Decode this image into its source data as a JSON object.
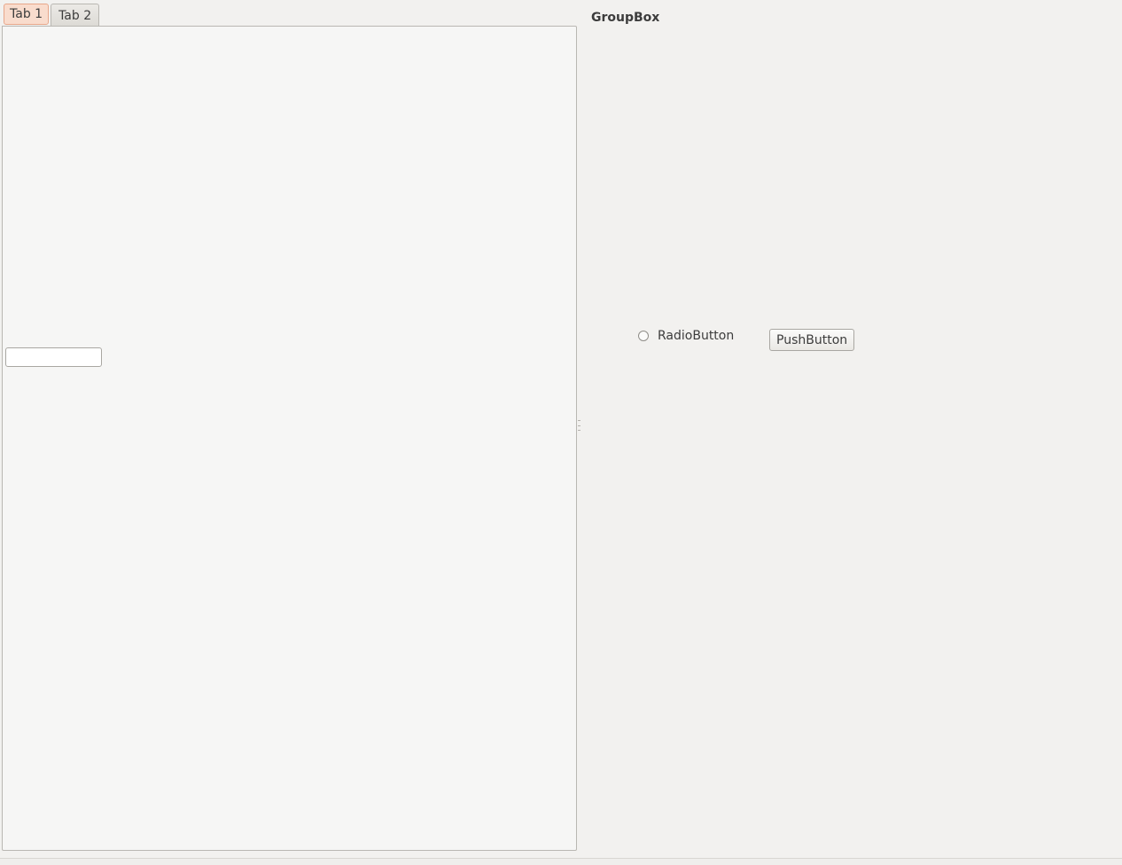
{
  "tabs": [
    {
      "label": "Tab 1",
      "active": true
    },
    {
      "label": "Tab 2",
      "active": false
    }
  ],
  "tab_pane": {
    "line_edit": {
      "value": "",
      "placeholder": ""
    }
  },
  "groupbox": {
    "title": "GroupBox",
    "radio": {
      "label": "RadioButton",
      "checked": false
    },
    "push_button": {
      "label": "PushButton"
    }
  },
  "colors": {
    "window_bg": "#f2f1ef",
    "active_tab_bg": "#f9dccd",
    "active_tab_border": "#e8a78a",
    "pane_bg": "#f6f6f5"
  }
}
